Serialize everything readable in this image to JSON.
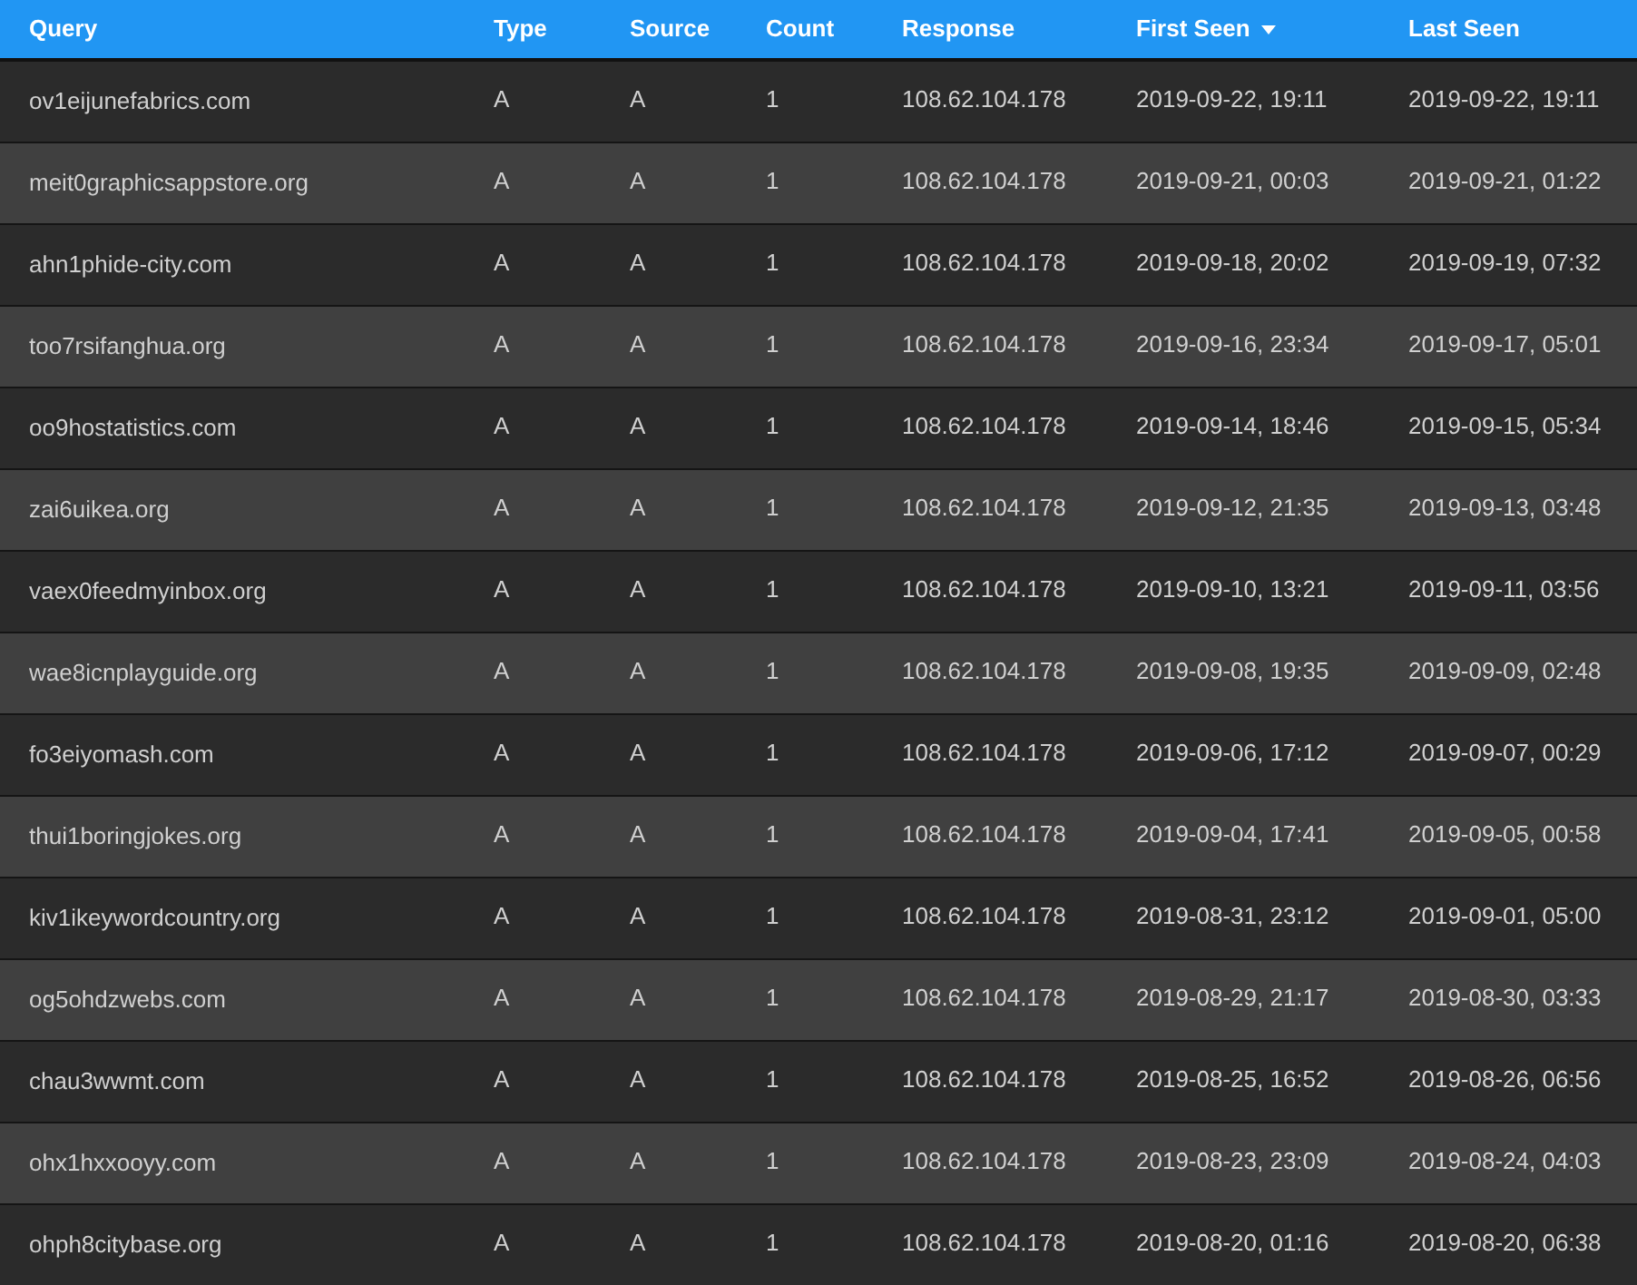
{
  "table": {
    "columns": [
      {
        "label": "Query",
        "sorted": false
      },
      {
        "label": "Type",
        "sorted": false
      },
      {
        "label": "Source",
        "sorted": false
      },
      {
        "label": "Count",
        "sorted": false
      },
      {
        "label": "Response",
        "sorted": false
      },
      {
        "label": "First Seen",
        "sorted": true
      },
      {
        "label": "Last Seen",
        "sorted": false
      }
    ],
    "rows": [
      [
        "ov1eijunefabrics.com",
        "A",
        "A",
        "1",
        "108.62.104.178",
        "2019-09-22, 19:11",
        "2019-09-22, 19:11"
      ],
      [
        "meit0graphicsappstore.org",
        "A",
        "A",
        "1",
        "108.62.104.178",
        "2019-09-21, 00:03",
        "2019-09-21, 01:22"
      ],
      [
        "ahn1phide-city.com",
        "A",
        "A",
        "1",
        "108.62.104.178",
        "2019-09-18, 20:02",
        "2019-09-19, 07:32"
      ],
      [
        "too7rsifanghua.org",
        "A",
        "A",
        "1",
        "108.62.104.178",
        "2019-09-16, 23:34",
        "2019-09-17, 05:01"
      ],
      [
        "oo9hostatistics.com",
        "A",
        "A",
        "1",
        "108.62.104.178",
        "2019-09-14, 18:46",
        "2019-09-15, 05:34"
      ],
      [
        "zai6uikea.org",
        "A",
        "A",
        "1",
        "108.62.104.178",
        "2019-09-12, 21:35",
        "2019-09-13, 03:48"
      ],
      [
        "vaex0feedmyinbox.org",
        "A",
        "A",
        "1",
        "108.62.104.178",
        "2019-09-10, 13:21",
        "2019-09-11, 03:56"
      ],
      [
        "wae8icnplayguide.org",
        "A",
        "A",
        "1",
        "108.62.104.178",
        "2019-09-08, 19:35",
        "2019-09-09, 02:48"
      ],
      [
        "fo3eiyomash.com",
        "A",
        "A",
        "1",
        "108.62.104.178",
        "2019-09-06, 17:12",
        "2019-09-07, 00:29"
      ],
      [
        "thui1boringjokes.org",
        "A",
        "A",
        "1",
        "108.62.104.178",
        "2019-09-04, 17:41",
        "2019-09-05, 00:58"
      ],
      [
        "kiv1ikeywordcountry.org",
        "A",
        "A",
        "1",
        "108.62.104.178",
        "2019-08-31, 23:12",
        "2019-09-01, 05:00"
      ],
      [
        "og5ohdzwebs.com",
        "A",
        "A",
        "1",
        "108.62.104.178",
        "2019-08-29, 21:17",
        "2019-08-30, 03:33"
      ],
      [
        "chau3wwmt.com",
        "A",
        "A",
        "1",
        "108.62.104.178",
        "2019-08-25, 16:52",
        "2019-08-26, 06:56"
      ],
      [
        "ohx1hxxooyy.com",
        "A",
        "A",
        "1",
        "108.62.104.178",
        "2019-08-23, 23:09",
        "2019-08-24, 04:03"
      ],
      [
        "ohph8citybase.org",
        "A",
        "A",
        "1",
        "108.62.104.178",
        "2019-08-20, 01:16",
        "2019-08-20, 06:38"
      ]
    ]
  }
}
